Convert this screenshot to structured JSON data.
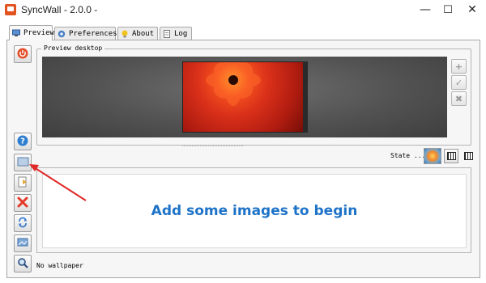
{
  "window": {
    "title": "SyncWall - 2.0.0 -",
    "minimize_glyph": "—",
    "maximize_glyph": "☐",
    "close_glyph": "✕"
  },
  "tabs": [
    {
      "label": "Preview",
      "icon": "monitor-icon",
      "active": true
    },
    {
      "label": "Preferences",
      "icon": "gear-icon",
      "active": false
    },
    {
      "label": "About",
      "icon": "lightbulb-icon",
      "active": false
    },
    {
      "label": "Log",
      "icon": "notepad-icon",
      "active": false
    }
  ],
  "preview": {
    "group_label": "Preview desktop"
  },
  "state": {
    "label": "State ..."
  },
  "list": {
    "placeholder": "Add some images to begin"
  },
  "status": {
    "text": "No wallpaper"
  },
  "colors": {
    "accent_text": "#1e73c8",
    "annotation_arrow": "#e02828",
    "power_button": "#e4502a",
    "remove_button": "#e33b2a"
  }
}
